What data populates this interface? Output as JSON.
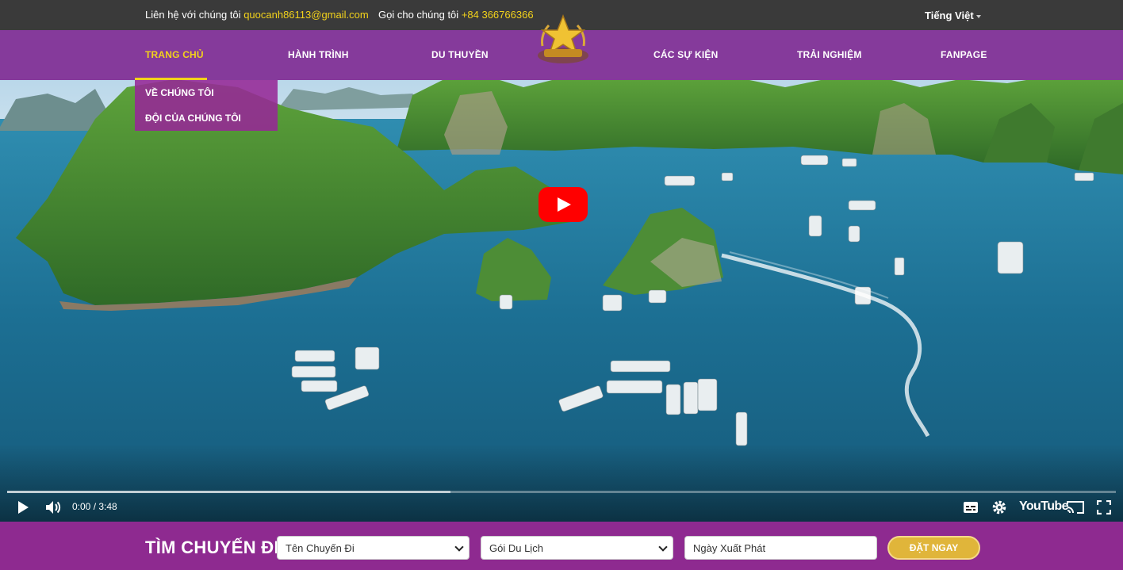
{
  "topbar": {
    "contact_label": "Liên hệ với chúng tôi",
    "email": "quocanh86113@gmail.com",
    "phone_label": "Gọi cho chúng tôi",
    "phone": "+84 366766366",
    "language": "Tiếng Việt"
  },
  "nav": {
    "items": [
      "TRANG CHỦ",
      "HÀNH TRÌNH",
      "DU THUYỀN",
      "CÁC SỰ KIỆN",
      "TRẢI NGHIỆM",
      "FANPAGE"
    ],
    "active": "TRANG CHỦ"
  },
  "dropdown": {
    "items": [
      "VỀ CHÚNG TÔI",
      "ĐỘI CỦA CHÚNG TÔI"
    ]
  },
  "player": {
    "time": "0:00 / 3:48",
    "brand": "YouTube",
    "progress": 0.4
  },
  "search": {
    "title": "TÌM CHUYẾN ĐI",
    "trip_select": "Tên Chuyến Đi",
    "package_select": "Gói Du Lịch",
    "date_placeholder": "Ngày Xuất Phát",
    "submit": "ĐẶT NGAY"
  },
  "colors": {
    "accent_yellow": "#f2d21b",
    "nav_purple": "#9c2e9e",
    "search_purple": "#8e2a90",
    "button_gold": "#e0b53a",
    "youtube_red": "#ff0000"
  }
}
